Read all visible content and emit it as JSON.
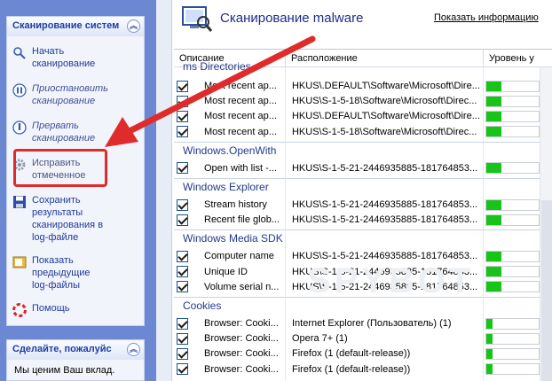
{
  "sidebar": {
    "panel1": {
      "title": "Сканирование систем",
      "tasks": [
        {
          "label": "Начать\nсканирование",
          "icon": "magnifier-icon",
          "state": "normal"
        },
        {
          "label": "Приостановить\nсканирование",
          "icon": "pause-icon",
          "state": "italic"
        },
        {
          "label": "Прервать\nсканирование",
          "icon": "stop-icon",
          "state": "italic"
        },
        {
          "label": "Исправить\nотмеченное",
          "icon": "gear-icon",
          "state": "disabled"
        },
        {
          "label": "Сохранить\nрезультаты\nсканирования в\nlog-файле",
          "icon": "save-icon",
          "state": "normal"
        },
        {
          "label": "Показать\nпредыдущие\nlog-файлы",
          "icon": "log-icon",
          "state": "normal"
        },
        {
          "label": "Помощь",
          "icon": "lifebuoy-icon",
          "state": "normal"
        }
      ]
    },
    "panel2": {
      "title": "Сделайте, пожалуйс",
      "text": "Мы ценим Ваш вклад."
    }
  },
  "main": {
    "title": "Сканирование malware",
    "details_link": "Показать информацию",
    "columns": [
      "Описание",
      "Расположение",
      "Уровень у"
    ],
    "partial_group": "ms Directories",
    "rows": [
      {
        "type": "item",
        "desc": "Most recent ap...",
        "loc": "HKUS\\.DEFAULT\\Software\\Microsoft\\Dire...",
        "level": 0.3
      },
      {
        "type": "item",
        "desc": "Most recent ap...",
        "loc": "HKUS\\S-1-5-18\\Software\\Microsoft\\Direc...",
        "level": 0.3
      },
      {
        "type": "item",
        "desc": "Most recent ap...",
        "loc": "HKUS\\.DEFAULT\\Software\\Microsoft\\Dire...",
        "level": 0.3
      },
      {
        "type": "item",
        "desc": "Most recent ap...",
        "loc": "HKUS\\S-1-5-18\\Software\\Microsoft\\Direc...",
        "level": 0.3
      },
      {
        "type": "group",
        "label": "Windows.OpenWith"
      },
      {
        "type": "item",
        "desc": "Open with list -...",
        "loc": "HKUS\\S-1-5-21-2446935885-181764853...",
        "level": 0.3
      },
      {
        "type": "group",
        "label": "Windows Explorer"
      },
      {
        "type": "item",
        "desc": "Stream history",
        "loc": "HKUS\\S-1-5-21-2446935885-181764853...",
        "level": 0.3
      },
      {
        "type": "item",
        "desc": "Recent file glob...",
        "loc": "HKUS\\S-1-5-21-2446935885-181764853...",
        "level": 0.3
      },
      {
        "type": "group",
        "label": "Windows Media SDK"
      },
      {
        "type": "item",
        "desc": "Computer name",
        "loc": "HKUS\\S-1-5-21-2446935885-181764853...",
        "level": 0.3
      },
      {
        "type": "item",
        "desc": "Unique ID",
        "loc": "HKUS\\S-1-5-21-2446935885-181764853...",
        "level": 0.3
      },
      {
        "type": "item",
        "desc": "Volume serial n...",
        "loc": "HKUS\\S-1-5-21-2446935885-181764853...",
        "level": 0.3
      },
      {
        "type": "group",
        "label": "Cookies"
      },
      {
        "type": "item",
        "desc": "Browser: Cooki...",
        "loc": "Internet Explorer (Пользователь) (1)",
        "level": 0.12
      },
      {
        "type": "item",
        "desc": "Browser: Cooki...",
        "loc": "Opera 7+ (1)",
        "level": 0.12
      },
      {
        "type": "item",
        "desc": "Browser: Cooki...",
        "loc": "Firefox (1 (default-release))",
        "level": 0.12
      },
      {
        "type": "item",
        "desc": "Browser: Cooki...",
        "loc": "Firefox (1 (default-release))",
        "level": 0.12
      }
    ],
    "watermark": "SPYBOT"
  },
  "colors": {
    "level_fill": "#17c417",
    "sidebar_bg": "#6d88d3",
    "highlight": "#e02b2b"
  }
}
